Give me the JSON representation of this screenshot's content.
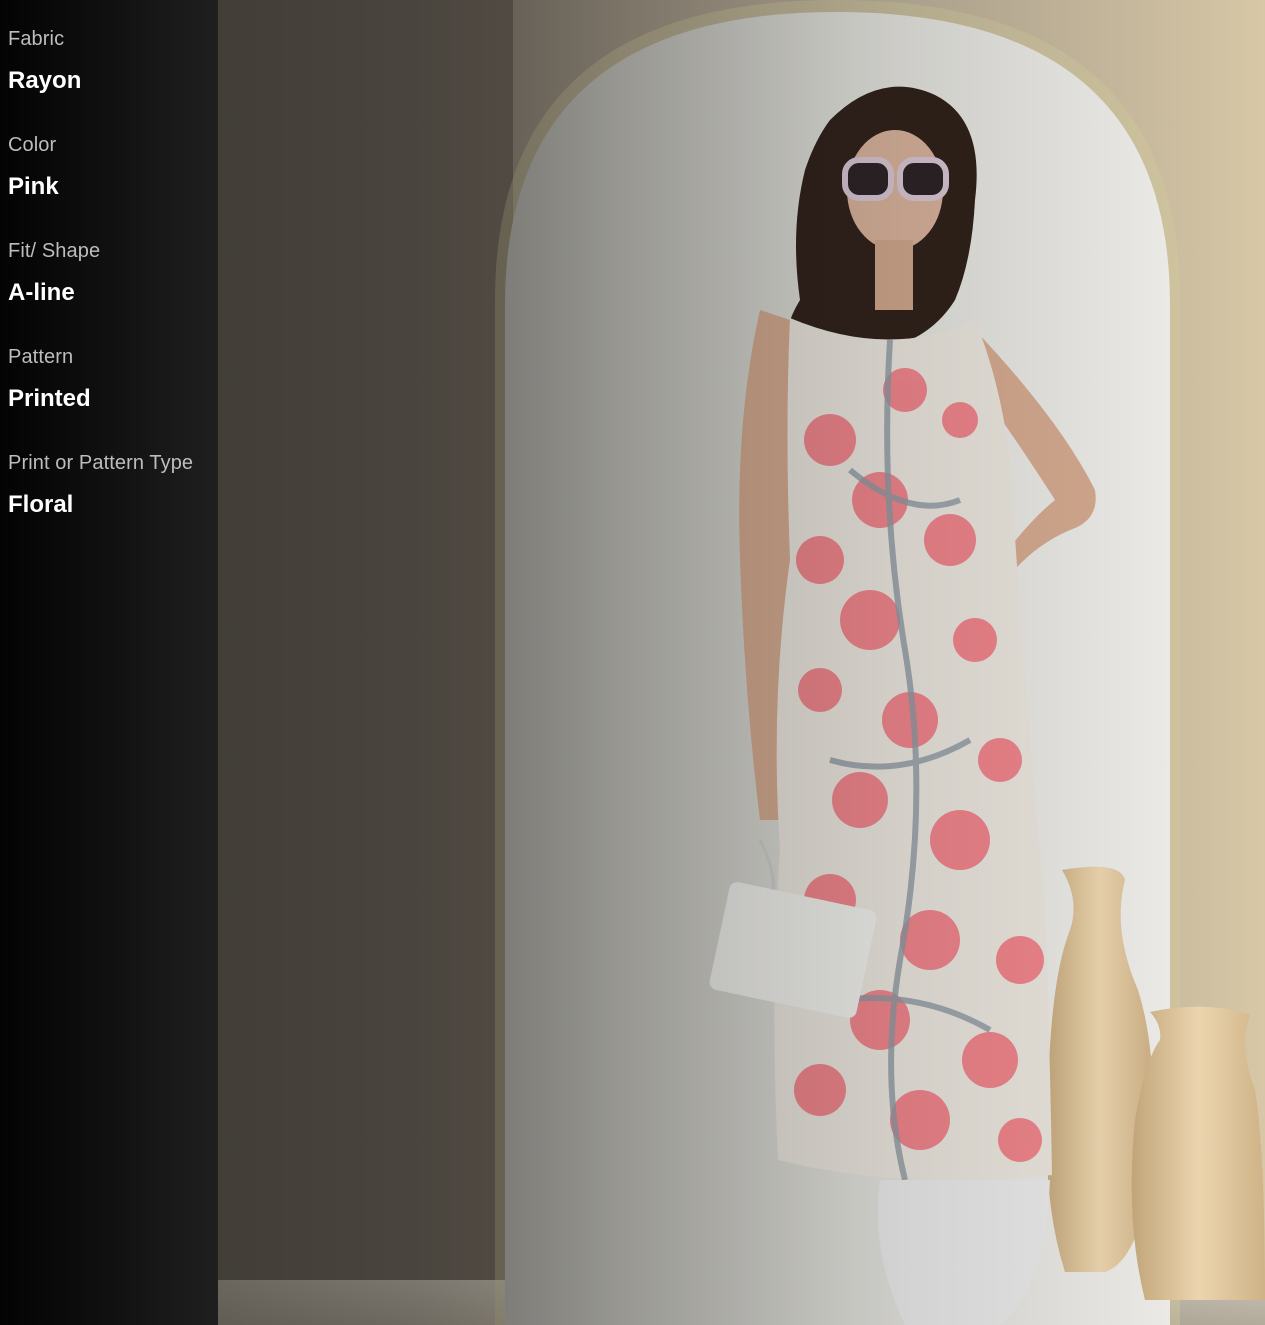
{
  "attributes": [
    {
      "label": "Fabric",
      "value": "Rayon"
    },
    {
      "label": "Color",
      "value": "Pink"
    },
    {
      "label": "Fit/ Shape",
      "value": "A-line"
    },
    {
      "label": "Pattern",
      "value": "Printed"
    },
    {
      "label": "Print or Pattern Type",
      "value": "Floral"
    }
  ],
  "product_image": {
    "description_icon": "product-photo",
    "colors": {
      "wall": "#a59d90",
      "arch": "#d8d8d2",
      "dress_base": "#e9e6df",
      "flower": "#f07f86",
      "branch": "#8e9aa3",
      "vase": "#d9c29e"
    }
  }
}
